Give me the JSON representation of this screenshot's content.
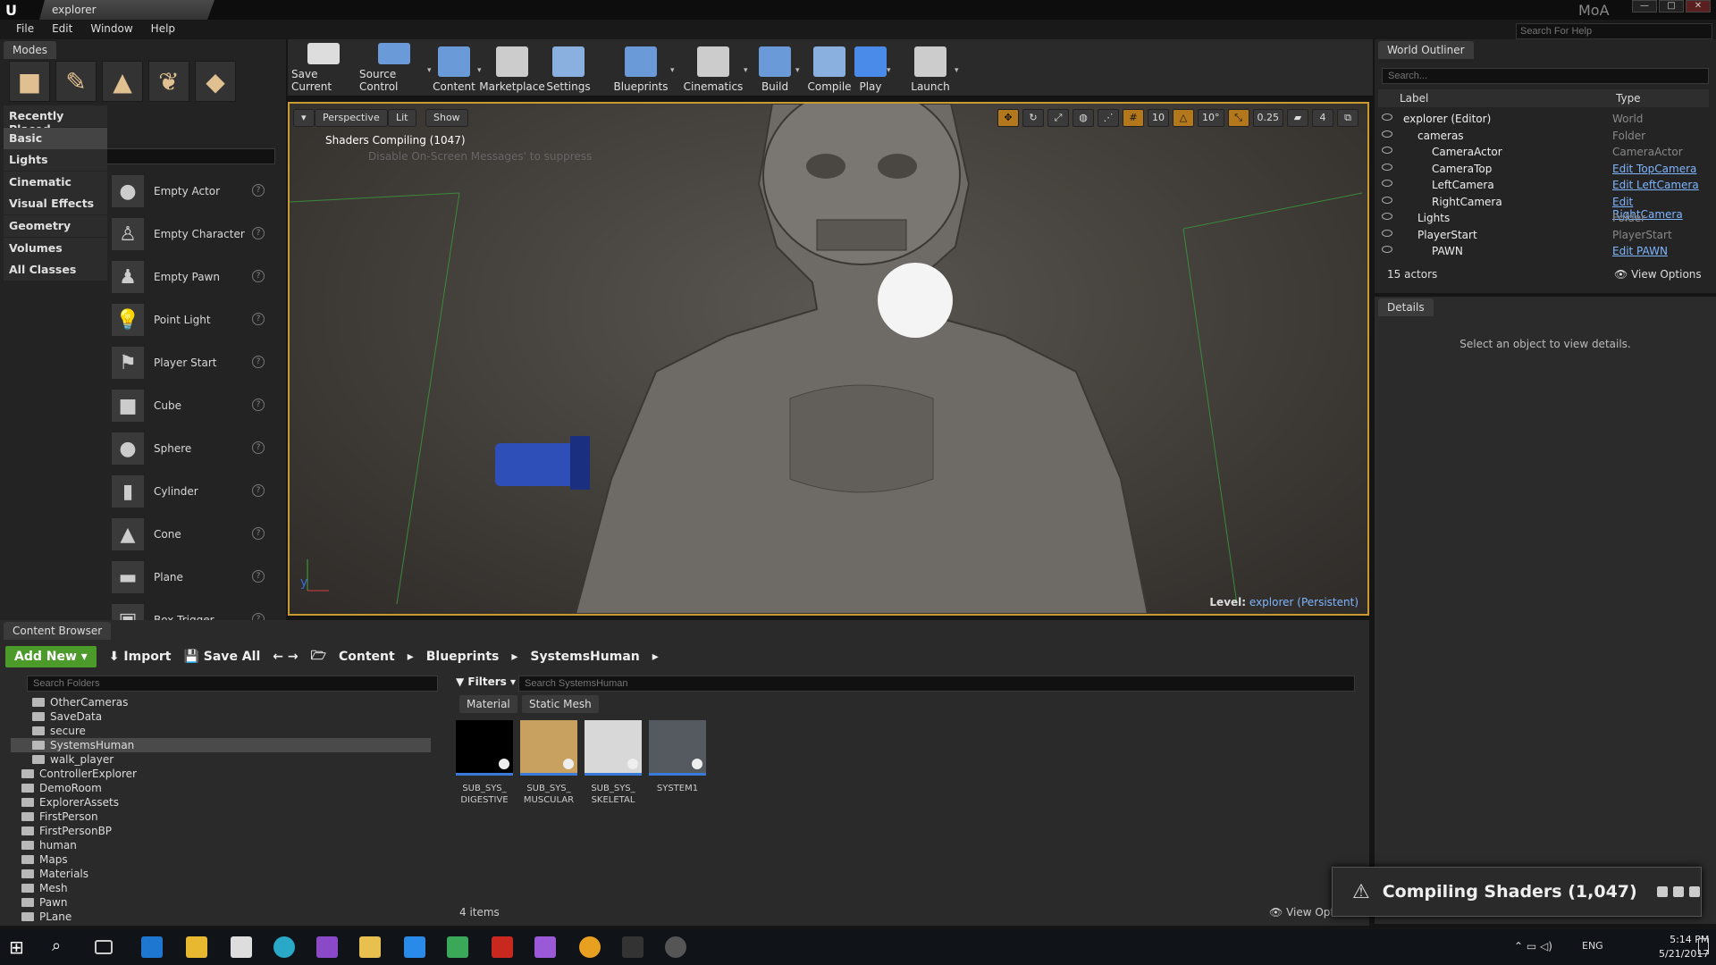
{
  "window": {
    "title": "explorer",
    "user": "MoA",
    "help_search_placeholder": "Search For Help"
  },
  "menu": [
    "File",
    "Edit",
    "Window",
    "Help"
  ],
  "modes": {
    "tab_label": "Modes",
    "search_placeholder": "Search Classes",
    "categories": [
      "Recently Placed",
      "Basic",
      "Lights",
      "Cinematic",
      "Visual Effects",
      "Geometry",
      "Volumes",
      "All Classes"
    ],
    "active_category": "Basic",
    "items": [
      "Empty Actor",
      "Empty Character",
      "Empty Pawn",
      "Point Light",
      "Player Start",
      "Cube",
      "Sphere",
      "Cylinder",
      "Cone",
      "Plane",
      "Box Trigger",
      "Sphere Trigger"
    ]
  },
  "toolbar": [
    "Save Current",
    "Source Control",
    "Content",
    "Marketplace",
    "Settings",
    "Blueprints",
    "Cinematics",
    "Build",
    "Compile",
    "Play",
    "Launch"
  ],
  "viewport": {
    "perspective": "Perspective",
    "lit": "Lit",
    "show": "Show",
    "grid": "10",
    "rotation": "10°",
    "scale": "0.25",
    "speed": "4",
    "shaders_compiling": "Shaders Compiling (1047)",
    "ghost_message": "Disable On-Screen Messages' to suppress",
    "level_prefix": "Level:",
    "level_name": "explorer (Persistent)"
  },
  "outliner": {
    "tab_label": "World Outliner",
    "search_placeholder": "Search...",
    "col_label": "Label",
    "col_type": "Type",
    "rows": [
      {
        "label": "explorer (Editor)",
        "type": "World",
        "link": false,
        "indent": 0
      },
      {
        "label": "cameras",
        "type": "Folder",
        "link": false,
        "indent": 1
      },
      {
        "label": "CameraActor",
        "type": "CameraActor",
        "link": false,
        "indent": 2
      },
      {
        "label": "CameraTop",
        "type": "Edit TopCamera",
        "link": true,
        "indent": 2
      },
      {
        "label": "LeftCamera",
        "type": "Edit LeftCamera",
        "link": true,
        "indent": 2
      },
      {
        "label": "RightCamera",
        "type": "Edit RightCamera",
        "link": true,
        "indent": 2
      },
      {
        "label": "Lights",
        "type": "Folder",
        "link": false,
        "indent": 1
      },
      {
        "label": "PlayerStart",
        "type": "PlayerStart",
        "link": false,
        "indent": 1
      },
      {
        "label": "PAWN",
        "type": "Edit PAWN",
        "link": true,
        "indent": 2
      }
    ],
    "actor_count": "15 actors",
    "view_options": "View Options"
  },
  "details": {
    "tab_label": "Details",
    "message": "Select an object to view details."
  },
  "content_browser": {
    "tab_label": "Content Browser",
    "add_new": "Add New",
    "import": "Import",
    "save_all": "Save All",
    "breadcrumbs": [
      "Content",
      "Blueprints",
      "SystemsHuman"
    ],
    "folder_search_placeholder": "Search Folders",
    "asset_search_placeholder": "Search SystemsHuman",
    "filters_label": "Filters",
    "filter_tags": [
      "Material",
      "Static Mesh"
    ],
    "folders": [
      {
        "name": "OtherCameras",
        "indent": 2,
        "selected": false
      },
      {
        "name": "SaveData",
        "indent": 2,
        "selected": false
      },
      {
        "name": "secure",
        "indent": 2,
        "selected": false
      },
      {
        "name": "SystemsHuman",
        "indent": 2,
        "selected": true
      },
      {
        "name": "walk_player",
        "indent": 2,
        "selected": false
      },
      {
        "name": "ControllerExplorer",
        "indent": 1,
        "selected": false
      },
      {
        "name": "DemoRoom",
        "indent": 1,
        "selected": false
      },
      {
        "name": "ExplorerAssets",
        "indent": 1,
        "selected": false
      },
      {
        "name": "FirstPerson",
        "indent": 1,
        "selected": false
      },
      {
        "name": "FirstPersonBP",
        "indent": 1,
        "selected": false
      },
      {
        "name": "human",
        "indent": 1,
        "selected": false
      },
      {
        "name": "Maps",
        "indent": 1,
        "selected": false
      },
      {
        "name": "Materials",
        "indent": 1,
        "selected": false
      },
      {
        "name": "Mesh",
        "indent": 1,
        "selected": false
      },
      {
        "name": "Pawn",
        "indent": 1,
        "selected": false
      },
      {
        "name": "PLane",
        "indent": 1,
        "selected": false
      }
    ],
    "assets": [
      {
        "name": "SUB_SYS_ DIGESTIVE",
        "thumb": "#000000"
      },
      {
        "name": "SUB_SYS_ MUSCULAR",
        "thumb": "#c8a060"
      },
      {
        "name": "SUB_SYS_ SKELETAL",
        "thumb": "#d8d8d8"
      },
      {
        "name": "SYSTEM1",
        "thumb": "#555a60"
      }
    ],
    "item_count": "4 items",
    "view_options": "View Options"
  },
  "toast": {
    "message": "Compiling Shaders (1,047)"
  },
  "taskbar": {
    "time": "5:14 PM",
    "date": "5/21/2017",
    "language": "ENG"
  },
  "colors": {
    "accent": "#c89a30",
    "link": "#7fb5ff",
    "add_new": "#4c9a2a"
  }
}
